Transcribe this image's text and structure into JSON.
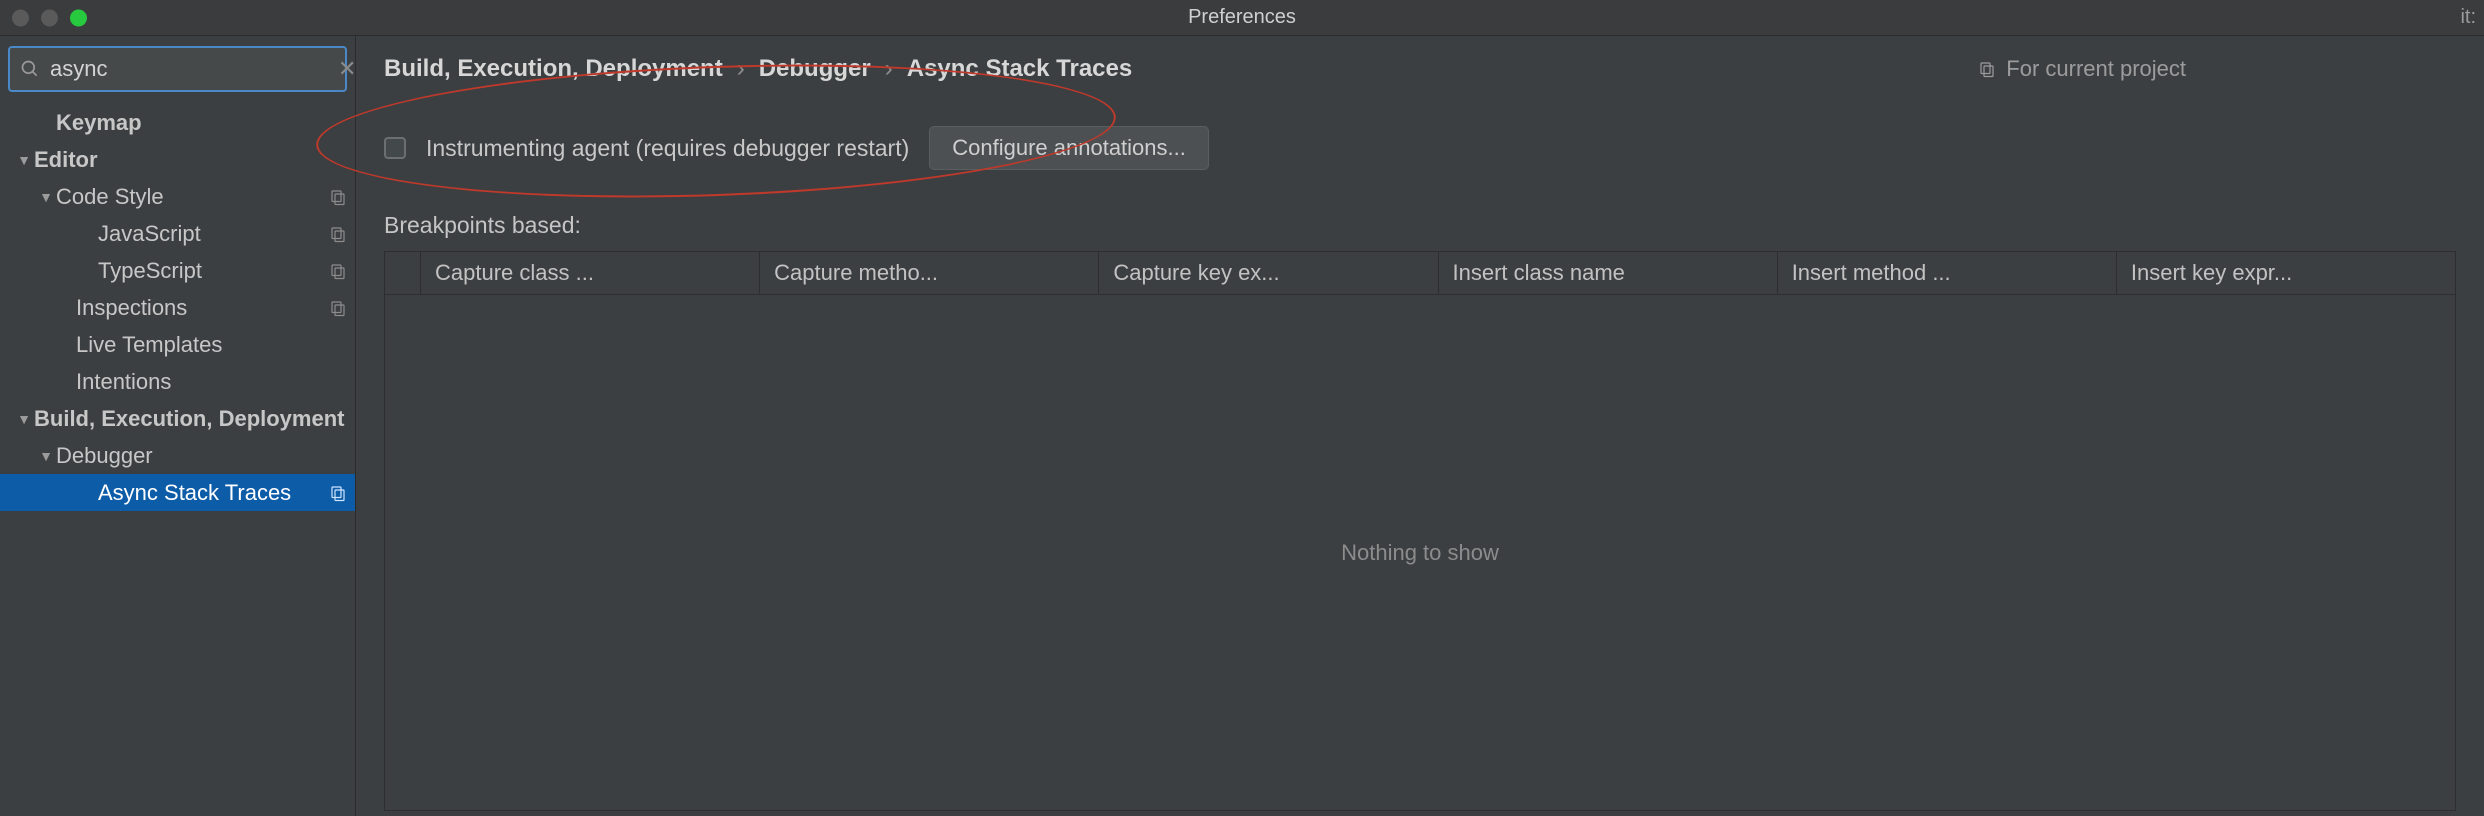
{
  "window": {
    "title": "Preferences",
    "right_fragment": "it:"
  },
  "search": {
    "value": "async",
    "clear_glyph": "✕"
  },
  "sidebar": {
    "items": [
      {
        "label": "Keymap",
        "indent": "indent-0",
        "arrow": "",
        "copy": false
      },
      {
        "label": "Editor",
        "indent": "indent-0a",
        "arrow": "▼",
        "copy": false
      },
      {
        "label": "Code Style",
        "indent": "indent-1",
        "arrow": "▼",
        "copy": true
      },
      {
        "label": "JavaScript",
        "indent": "indent-2",
        "arrow": "",
        "copy": true
      },
      {
        "label": "TypeScript",
        "indent": "indent-2",
        "arrow": "",
        "copy": true
      },
      {
        "label": "Inspections",
        "indent": "indent-1a",
        "arrow": "",
        "copy": true
      },
      {
        "label": "Live Templates",
        "indent": "indent-1a",
        "arrow": "",
        "copy": false
      },
      {
        "label": "Intentions",
        "indent": "indent-1a",
        "arrow": "",
        "copy": false
      },
      {
        "label": "Build, Execution, Deployment",
        "indent": "indent-0a",
        "arrow": "▼",
        "copy": false
      },
      {
        "label": "Debugger",
        "indent": "indent-1",
        "arrow": "▼",
        "copy": false
      },
      {
        "label": "Async Stack Traces",
        "indent": "indent-2",
        "arrow": "",
        "copy": true,
        "selected": true
      }
    ]
  },
  "breadcrumb": {
    "parts": [
      "Build, Execution, Deployment",
      "Debugger",
      "Async Stack Traces"
    ],
    "sep": "›"
  },
  "for_project_label": "For current project",
  "checkbox_label": "Instrumenting agent (requires debugger restart)",
  "configure_button": "Configure annotations...",
  "section_title": "Breakpoints based:",
  "table": {
    "headers": [
      "",
      "Capture class ...",
      "Capture metho...",
      "Capture key ex...",
      "Insert class name",
      "Insert method ...",
      "Insert key expr..."
    ],
    "empty_text": "Nothing to show"
  }
}
